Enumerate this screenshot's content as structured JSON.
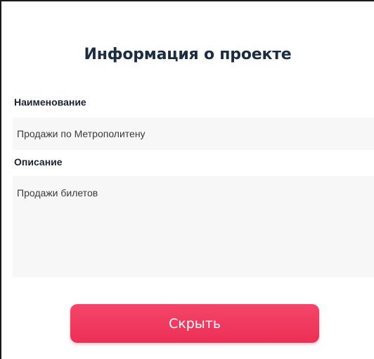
{
  "panel": {
    "title": "Информация о проекте",
    "name_label": "Наименование",
    "name_value": "Продажи по Метрополитену",
    "description_label": "Описание",
    "description_value": "Продажи билетов",
    "hide_button_label": "Скрыть",
    "accent_color": "#ec2f55",
    "title_color": "#1b2d45"
  }
}
